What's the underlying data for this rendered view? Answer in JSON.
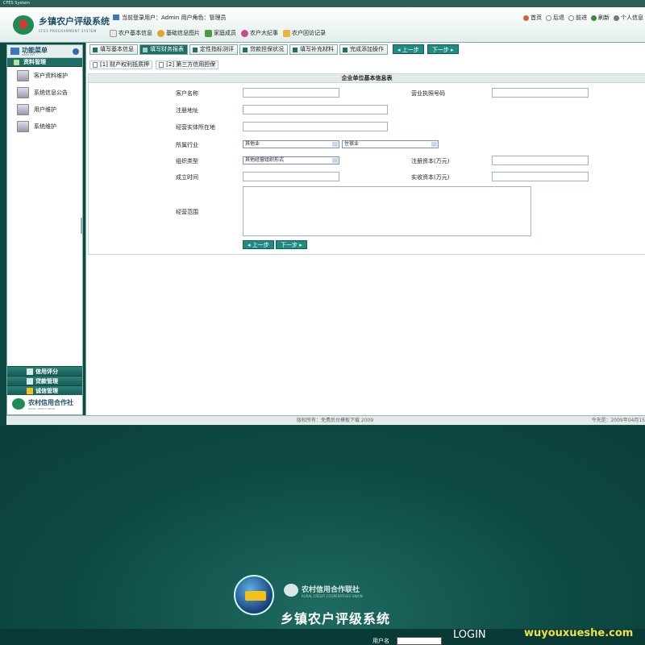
{
  "window": {
    "title": "CFES System"
  },
  "header": {
    "app_title": "乡镇农户评级系统",
    "app_subtitle": "CFES PROGRAMMENT SYSTEM",
    "user_info": "当前登录用户：Admin  用户角色：管理员",
    "quick_links": [
      "农户基本信息",
      "基础信息图片",
      "家庭成员",
      "农户大纪事",
      "农户回访记录"
    ],
    "right_links": [
      "首页",
      "后退",
      "前进",
      "刷新",
      "个人信息"
    ]
  },
  "sidebar": {
    "title": "功能菜单",
    "subtitle": "MENU LIST",
    "section": "资料管理",
    "items": [
      {
        "label": "客户资料维护",
        "icon": "customer-icon"
      },
      {
        "label": "系统信息公告",
        "icon": "notice-icon"
      },
      {
        "label": "用户维护",
        "icon": "user-icon"
      },
      {
        "label": "系统维护",
        "icon": "system-icon"
      }
    ],
    "bottom_sections": [
      "信用评分",
      "贷款管理",
      "诚信管理"
    ],
    "logo_text": "农村信用合作社",
    "logo_sub": "RURAL CREDIT UNION"
  },
  "tabs": [
    {
      "label": "填写基本信息",
      "active": false
    },
    {
      "label": "填写财务报表",
      "active": true
    },
    {
      "label": "定性指标测评",
      "active": false
    },
    {
      "label": "贷款担保状况",
      "active": false
    },
    {
      "label": "填写补充材料",
      "active": false
    },
    {
      "label": "完成添加操作",
      "active": false
    }
  ],
  "nav_buttons": {
    "prev": "上一步",
    "next": "下一步"
  },
  "subtabs": [
    "[1] 财产权利抵质押",
    "[2] 第三方信用担保"
  ],
  "form": {
    "title": "企业单位基本信息表",
    "labels": {
      "customer_name": "客户名称",
      "license_no": "营业执照号码",
      "reg_address": "注册地址",
      "biz_location": "经营实体所在地",
      "industry": "所属行业",
      "org_type": "组织类型",
      "reg_capital": "注册资本(万元)",
      "established": "成立时间",
      "paid_capital": "实收资本(万元)",
      "biz_scope": "经营范围"
    },
    "industry_select_1": "其他业",
    "industry_select_2": "住宿业",
    "org_type_select": "其他经营组织形式",
    "buttons": {
      "prev": "上一步",
      "next": "下一步"
    }
  },
  "statusbar": {
    "center": "版权所有：免费后台模板下载 2009",
    "right": "今天是：2009年04月15"
  },
  "login": {
    "assoc_name": "农村信用合作联社",
    "assoc_sub": "RURAL CREDIT COOPERATIVES UNION",
    "system_title": "乡镇农户评级系统",
    "username_label": "用户名",
    "login_word": "LOGIN",
    "logo_text": "CFES"
  },
  "watermark": "wuyouxueshe.com",
  "colors": {
    "accent": "#1f6e66",
    "background": "#0d4a43",
    "button": "#1f8c82"
  }
}
